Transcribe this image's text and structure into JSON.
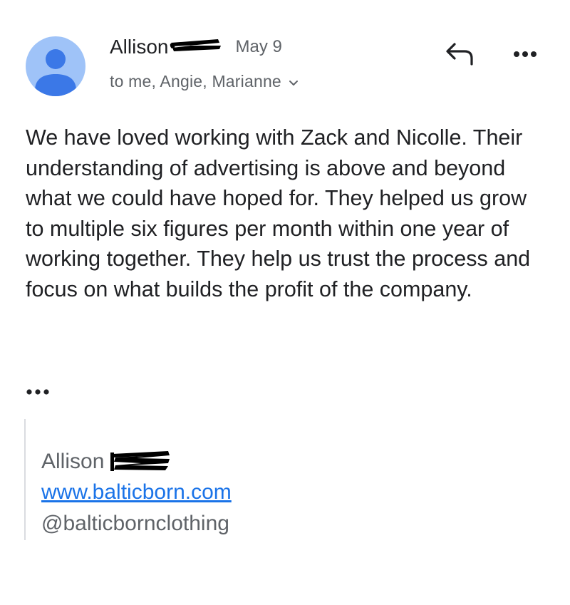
{
  "header": {
    "avatar_icon": "person-avatar-icon",
    "sender_name": "Allison",
    "date": "May 9",
    "recipients": "to me, Angie, Marianne",
    "expand_icon": "chevron-down-icon",
    "reply_icon": "reply-arrow-icon",
    "more_icon": "more-horizontal-icon"
  },
  "message": {
    "body": "We have loved working with Zack and Nicolle. Their understanding of advertising is above and beyond what we could have hoped for. They helped us grow to multiple six figures per month within one year of working together. They help us trust the process and focus on what builds the profit of the company.",
    "trimmed_content_icon": "ellipsis-icon"
  },
  "signature": {
    "name": "Allison",
    "website": "www.balticborn.com",
    "handle": "@balticbornclothing"
  },
  "colors": {
    "avatar_bg": "#9fc3f8",
    "avatar_fg": "#3b78e7",
    "link": "#1a73e8",
    "secondary_text": "#5f6368",
    "redaction": "#000000"
  }
}
